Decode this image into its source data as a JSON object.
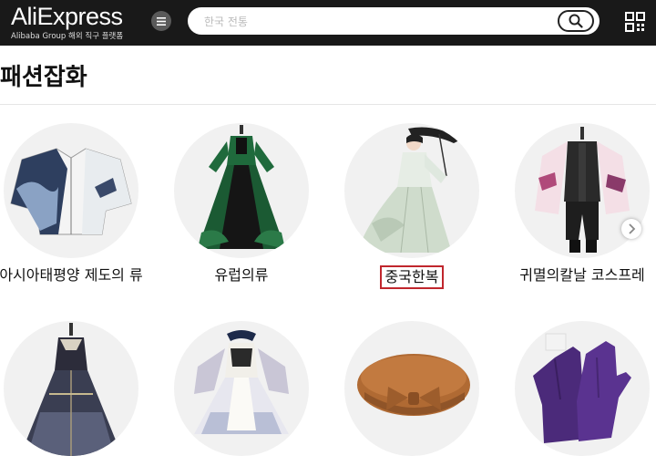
{
  "header": {
    "logo_text": "AliExpress",
    "logo_subtitle": "Alibaba Group 해외 직구 플랫폼",
    "menu_icon": "hamburger-icon",
    "search_placeholder": "한국 전통",
    "search_icon": "search-icon",
    "qr_icon": "qr-code-icon"
  },
  "page": {
    "title": "패션잡화"
  },
  "categories": [
    {
      "label": "아시아태평양 제도의 류"
    },
    {
      "label": "유럽의류"
    },
    {
      "label": "중국한복",
      "highlighted": true
    },
    {
      "label": "귀멸의칼날 코스프레"
    },
    {
      "label": ""
    },
    {
      "label": ""
    },
    {
      "label": ""
    },
    {
      "label": ""
    }
  ],
  "colors": {
    "header_bg": "#191919",
    "highlight_border": "#c0262d",
    "circle_bg": "#f1f1f1"
  }
}
